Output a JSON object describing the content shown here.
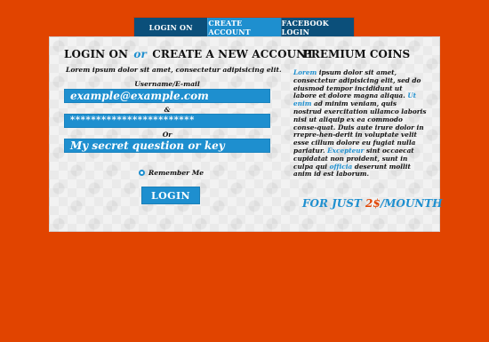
{
  "colors": {
    "background": "#e14400",
    "tab_active": "#1e8fcf",
    "tab_inactive": "#0b4f7a",
    "accent": "#1e8fcf",
    "price_highlight": "#e14400",
    "panel": "#f2f2f2"
  },
  "tabs": [
    {
      "label": "LOGIN ON"
    },
    {
      "label": "CREATE ACCOUNT"
    },
    {
      "label": "FACEBOOK LOGIN"
    }
  ],
  "left": {
    "title_part1": "LOGIN ON",
    "title_or": "or",
    "title_part2": "CREATE A NEW ACCOUNT",
    "lead": "Lorem ipsum dolor sit amet, consectetur adipisicing elit.",
    "label_user": "Username/E-mail",
    "label_amp": "&",
    "label_or": "Or",
    "field_user_value": "example@example.com",
    "field_password_value": "************************",
    "field_secret_value": "My secret question or key",
    "remember_label": "Remember Me",
    "login_button": "LOGIN"
  },
  "right": {
    "title": "PREMIUM COINS",
    "p1": "Lorem",
    "p2": " ipsum dolor sit amet, consectetur adipisicing elit, sed do eiusmod tempor incididunt ut labore et dolore magna aliqua. ",
    "p3": "Ut enim",
    "p4": " ad minim veniam, quis nostrud exercitation ullamco laboris nisi ut aliquip ex ea commodo conse-quat. Duis aute irure dolor in rrepre-hen-derit in voluptate velit esse cillum dolore eu fugiat nulla pariatur. ",
    "p5": "Excepteur",
    "p6": " sint occaecat cupidatat non proident, sunt in culpa qui ",
    "p7": "officia",
    "p8": " deserunt mollit anim id est laborum.",
    "price_prefix": "FOR JUST ",
    "price_amount": "2$",
    "price_suffix": "/MOUNTH"
  }
}
